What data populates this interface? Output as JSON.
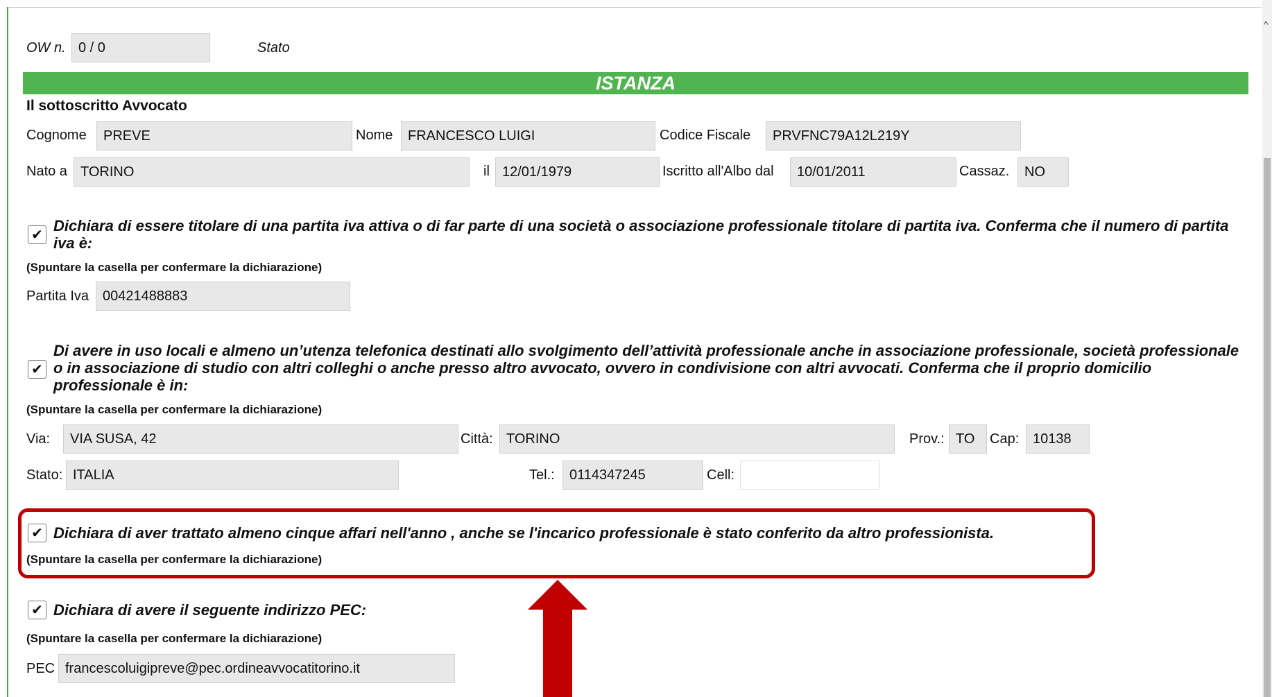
{
  "header": {
    "ow_label": "OW n.",
    "ow_value": "0 / 0",
    "stato_label": "Stato"
  },
  "section_title": "ISTANZA",
  "subscriber_heading": "Il sottoscritto Avvocato",
  "person": {
    "cognome_label": "Cognome",
    "cognome_value": "PREVE",
    "nome_label": "Nome",
    "nome_value": "FRANCESCO LUIGI",
    "cf_label": "Codice Fiscale",
    "cf_value": "PRVFNC79A12L219Y",
    "nato_label": "Nato a",
    "nato_value": "TORINO",
    "il_label": "il",
    "il_value": "12/01/1979",
    "albo_label": "Iscritto all'Albo dal",
    "albo_value": "10/01/2011",
    "cassaz_label": "Cassaz.",
    "cassaz_value": "NO"
  },
  "check_note": "(Spuntare la casella per confermare la dichiarazione)",
  "checkbox_mark": "✔",
  "decl1": {
    "text": "Dichiara di essere titolare di una partita iva attiva o di far parte di una società o associazione professionale titolare di partita iva. Conferma che il numero di partita iva è:",
    "piva_label": "Partita Iva",
    "piva_value": "00421488883",
    "checked": true
  },
  "decl2": {
    "text": "Di avere in uso locali e almeno un’utenza telefonica destinati allo svolgimento dell’attività professionale anche in associazione professionale, società professionale o in associazione di studio con altri colleghi o anche presso altro avvocato, ovvero in condivisione con altri avvocati. Conferma che il proprio domicilio professionale è in:",
    "via_label": "Via:",
    "via_value": "VIA SUSA, 42",
    "citta_label": "Città:",
    "citta_value": "TORINO",
    "prov_label": "Prov.:",
    "prov_value": "TO",
    "cap_label": "Cap:",
    "cap_value": "10138",
    "stato_label": "Stato:",
    "stato_value": "ITALIA",
    "tel_label": "Tel.:",
    "tel_value": "0114347245",
    "cell_label": "Cell:",
    "cell_value": "",
    "checked": true
  },
  "decl3": {
    "text": "Dichiara di aver trattato almeno cinque affari nell'anno , anche se l'incarico professionale è stato conferito da altro professionista.",
    "checked": true
  },
  "decl4": {
    "text": "Dichiara di avere il seguente indirizzo PEC:",
    "pec_label": "PEC",
    "pec_value": "francescoluigipreve@pec.ordineavvocatitorino.it",
    "checked": true
  },
  "colors": {
    "banner_green": "#50b450",
    "annotation_red": "#c00000",
    "field_bg": "#e8e8e8"
  }
}
